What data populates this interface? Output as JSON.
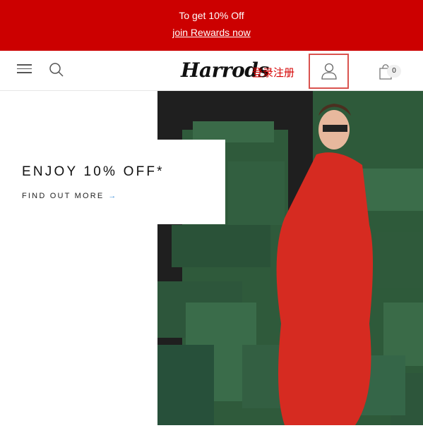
{
  "promo": {
    "text": "To get 10% Off",
    "link": "join Rewards now"
  },
  "header": {
    "logo": "Harrods",
    "login_label": "登录注册",
    "bag_count": "0"
  },
  "hero": {
    "headline": "ENJOY 10% OFF*",
    "cta": "FIND OUT MORE",
    "cta_arrow": "→"
  },
  "colors": {
    "promo_bg": "#cc0000",
    "login_text": "#d50000",
    "cta_arrow": "#3b8fd9"
  }
}
